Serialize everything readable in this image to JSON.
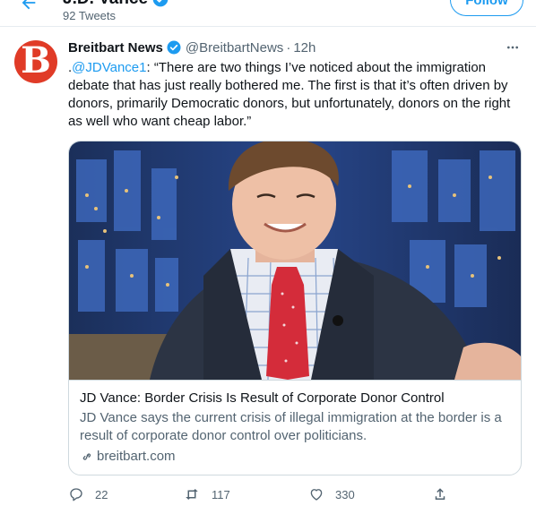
{
  "header": {
    "name": "J.D. Vance",
    "tweet_count": "92 Tweets",
    "follow_label": "Follow"
  },
  "tweet": {
    "author_name": "Breitbart News",
    "handle": "@BreitbartNews",
    "separator": "·",
    "time": "12h",
    "avatar_letter": "B",
    "text_prefix": ".",
    "mention": "@JDVance1",
    "text_body": ": “There are two things I’ve noticed about the immigration debate that has just really bothered me. The first is that it’s often driven by donors, primarily Democratic donors, but unfortunately, donors on the right as well who want cheap labor.”"
  },
  "card": {
    "title": "JD Vance: Border Crisis Is Result of Corporate Donor Control",
    "description": "JD Vance says the current crisis of illegal immigration at the border is a result of corporate donor control over politicians.",
    "domain": "breitbart.com"
  },
  "actions": {
    "replies": "22",
    "retweets": "117",
    "likes": "330"
  },
  "colors": {
    "accent": "#1d9bf0",
    "brand_avatar": "#e03b27",
    "text_primary": "#0f1419",
    "text_secondary": "#536471",
    "border": "#cfd9de"
  }
}
